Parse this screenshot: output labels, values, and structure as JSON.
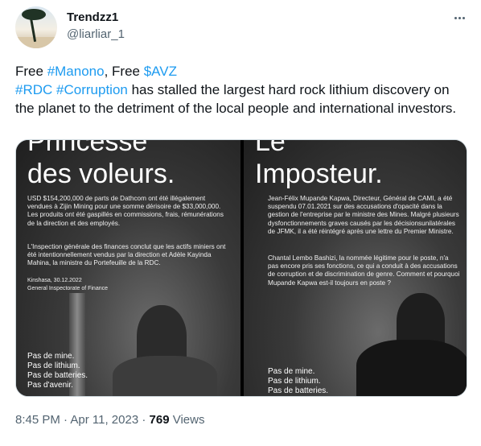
{
  "author": {
    "name": "Trendzz1",
    "handle": "@liarliar_1",
    "avatar_icon": "beach-palm-avatar-icon"
  },
  "more_icon": "more-horizontal-icon",
  "tweet": {
    "line1_prefix": "Free ",
    "tag_manono": "#Manono",
    "line1_mid": ", Free ",
    "tag_avz": "$AVZ",
    "tag_rdc": "#RDC",
    "tag_space": " ",
    "tag_corruption": "#Corruption",
    "body": " has stalled the largest hard rock lithium discovery on the planet to the detriment of the local people and international investors."
  },
  "media": {
    "left": {
      "title_top": "Princesse",
      "title_main": "des voleurs.",
      "para1": "USD $154,200,000 de parts de Dathcom ont été illégalement vendues à Zijin Mining pour une somme dérisoire de $33,000,000. Les produits ont été gaspillés en commissions, frais, rémunérations de la direction et des employés.",
      "para2": "L'Inspection générale des finances conclut que les actifs miniers ont été intentionnellement vendus par la direction et Adèle Kayinda Mahina, la ministre du Portefeuille de la RDC.",
      "source1": "Kinshasa, 30.12.2022",
      "source2": "General Inspectorate of Finance",
      "footer": [
        "Pas de mine.",
        "Pas de lithium.",
        "Pas de batteries.",
        "Pas d'avenir."
      ]
    },
    "right": {
      "title_top": "Le",
      "title_main": "Imposteur.",
      "para1": "Jean-Félix Mupande Kapwa, Directeur, Général de CAMI, a été suspendu 07.01.2021 sur des accusations d'opacité dans la gestion de l'entreprise par le ministre des Mines. Malgré plusieurs dysfonctionnements graves causés par les décisionsunilatérales de JFMK, il a été réintégré après une lettre du Premier Ministre.",
      "para2": "Chantal Lembo Bashizi, la nommée légitime pour le poste, n'a pas encore pris ses fonctions, ce qui a conduit à des accusations de corruption et de discrimination de genre. Comment et pourquoi Mupande Kapwa est-il toujours en poste ?",
      "footer": [
        "Pas de mine.",
        "Pas de lithium.",
        "Pas de batteries."
      ]
    }
  },
  "meta": {
    "time": "8:45 PM",
    "sep": " · ",
    "date": "Apr 11, 2023",
    "sep2": " · ",
    "views_count": "769",
    "views_label": " Views"
  }
}
